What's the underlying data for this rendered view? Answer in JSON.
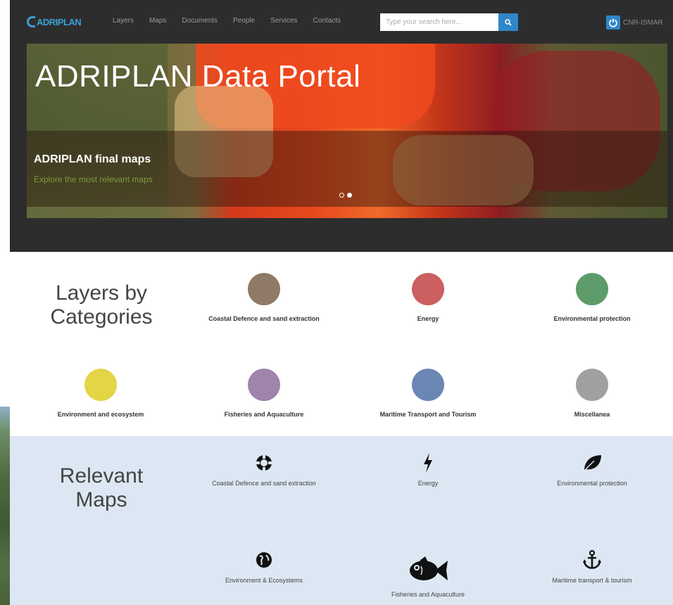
{
  "nav": {
    "logo": "ADRIPLAN",
    "links": [
      "Layers",
      "Maps",
      "Documents",
      "People",
      "Services",
      "Contacts"
    ],
    "search_placeholder": "Type your search here...",
    "user": "CNR-ISMAR"
  },
  "hero": {
    "title": "ADRIPLAN Data Portal",
    "caption_title": "ADRIPLAN final maps",
    "caption_subtitle": "Explore the most relevant maps",
    "slides": 2,
    "active_slide": 2
  },
  "categories": {
    "title_line1": "Layers by",
    "title_line2": "Categories",
    "items": [
      {
        "label": "Coastal Defence and sand extraction",
        "color": "#8e7a66"
      },
      {
        "label": "Energy",
        "color": "#cc5f5f"
      },
      {
        "label": "Environmental protection",
        "color": "#5d9c6a"
      },
      {
        "label": "Environment and ecosystem",
        "color": "#e3d545"
      },
      {
        "label": "Fisheries and Aquaculture",
        "color": "#9f84ac"
      },
      {
        "label": "Maritime Transport and Tourism",
        "color": "#6a86b2"
      },
      {
        "label": "Miscellanea",
        "color": "#a0a0a0"
      }
    ]
  },
  "maps": {
    "title_line1": "Relevant",
    "title_line2": "Maps",
    "items": [
      {
        "label": "Coastal Defence and sand extraction",
        "icon": "lifebuoy-icon"
      },
      {
        "label": "Energy",
        "icon": "lightning-icon"
      },
      {
        "label": "Environmental protection",
        "icon": "leaf-icon"
      },
      {
        "label": "Environment & Ecosystems",
        "icon": "globe-icon"
      },
      {
        "label": "Fisheries and Aquaculture",
        "icon": "fish-icon"
      },
      {
        "label": "Maritime transport & tourism",
        "icon": "anchor-icon"
      }
    ]
  }
}
